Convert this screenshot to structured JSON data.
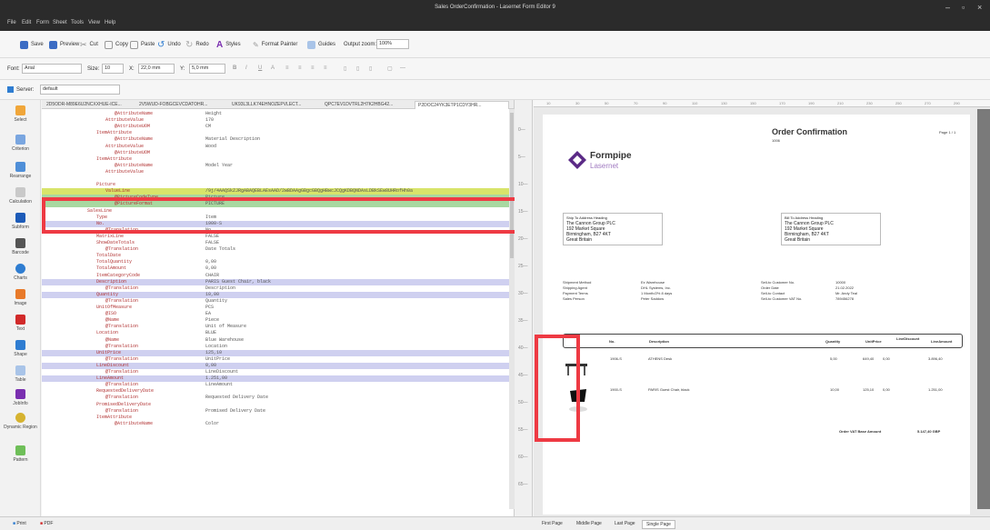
{
  "window": {
    "title": "Sales OrderConfirmation - Lasernet Form Editor 9"
  },
  "menu": [
    "File",
    "Edit",
    "Form",
    "Sheet",
    "Tools",
    "View",
    "Help"
  ],
  "toolbar1": {
    "save": "Save",
    "preview": "Preview",
    "cut": "Cut",
    "copy": "Copy",
    "paste": "Paste",
    "undo": "Undo",
    "redo": "Redo",
    "styles": "Styles",
    "format_painter": "Format Painter",
    "guides": "Guides",
    "output_zoom_label": "Output zoom:",
    "output_zoom_value": "100%"
  },
  "toolbar2": {
    "font_label": "Font:",
    "font_value": "Arial",
    "size_label": "Size:",
    "size_value": "10",
    "x_label": "X:",
    "x_value": "22,0 mm",
    "y_label": "Y:",
    "y_value": "5,0 mm"
  },
  "toolbar3": {
    "server_label": "Server:",
    "server_value": "default"
  },
  "tools": [
    "Select",
    "Criterion",
    "Rearrange",
    "Calculation",
    "Subform",
    "Barcode",
    "Charts",
    "Image",
    "Text",
    "Shape",
    "Table",
    "JobInfo",
    "Dynamic Region",
    "Pattern"
  ],
  "tabs": [
    "2D5ODR-M89E6U2NCXXHUE-ICE...",
    "2V5WUD-FOBGCEVCDATOHR...",
    "UK93L3LLK74EHNOZEPVLECT...",
    "QPC7EV1DVTRL2H7K2HBG42...",
    "P2DOC24YK3ETP1CDY3HR..."
  ],
  "xml_rows": [
    {
      "k": "@AttributeName",
      "v": "Height",
      "i": 4,
      "c": ""
    },
    {
      "k": "AttributeValue",
      "v": "170",
      "i": 3,
      "c": ""
    },
    {
      "k": "@AttributeUOM",
      "v": "CM",
      "i": 4,
      "c": ""
    },
    {
      "k": "ItemAttribute",
      "v": "",
      "i": 2,
      "c": ""
    },
    {
      "k": "@AttributeName",
      "v": "Material Description",
      "i": 4,
      "c": ""
    },
    {
      "k": "AttributeValue",
      "v": "Wood",
      "i": 3,
      "c": ""
    },
    {
      "k": "@AttributeUOM",
      "v": "",
      "i": 4,
      "c": ""
    },
    {
      "k": "ItemAttribute",
      "v": "",
      "i": 2,
      "c": ""
    },
    {
      "k": "@AttributeName",
      "v": "Model Year",
      "i": 4,
      "c": ""
    },
    {
      "k": "AttributeValue",
      "v": "",
      "i": 3,
      "c": ""
    },
    {
      "k": "",
      "v": "",
      "i": 0,
      "c": ""
    },
    {
      "k": "Picture",
      "v": "",
      "i": 2,
      "c": ""
    },
    {
      "k": "ValueLine",
      "v": "/9j/4AAQSkZJRgABAQEBLAEsAAD/2wBDAAgGBgcGBQgHBwcJCQgKDBQNDAsLDBkSEw8UHRofHh0a",
      "i": 3,
      "c": "yl"
    },
    {
      "k": "@PictureCodeType",
      "v": "Picture",
      "i": 4,
      "c": "gr"
    },
    {
      "k": "@PictureFormat",
      "v": "PICTURE",
      "i": 4,
      "c": "gr"
    },
    {
      "k": "SalesLine",
      "v": "",
      "i": 1,
      "c": ""
    },
    {
      "k": "Type",
      "v": "Item",
      "i": 2,
      "c": ""
    },
    {
      "k": "No.",
      "v": "1900-S",
      "i": 2,
      "c": "hl"
    },
    {
      "k": "@Translation",
      "v": "No.",
      "i": 3,
      "c": ""
    },
    {
      "k": "MatrixLine",
      "v": "FALSE",
      "i": 2,
      "c": ""
    },
    {
      "k": "ShowDateTotals",
      "v": "FALSE",
      "i": 2,
      "c": ""
    },
    {
      "k": "@Translation",
      "v": "Date Totals",
      "i": 3,
      "c": ""
    },
    {
      "k": "TotalDate",
      "v": "",
      "i": 2,
      "c": ""
    },
    {
      "k": "TotalQuantity",
      "v": "0,00",
      "i": 2,
      "c": ""
    },
    {
      "k": "TotalAmount",
      "v": "0,00",
      "i": 2,
      "c": ""
    },
    {
      "k": "ItemCategoryCode",
      "v": "CHAIR",
      "i": 2,
      "c": ""
    },
    {
      "k": "Description",
      "v": "PARIS Guest Chair, black",
      "i": 2,
      "c": "hl"
    },
    {
      "k": "@Translation",
      "v": "Description",
      "i": 3,
      "c": ""
    },
    {
      "k": "Quantity",
      "v": "10,00",
      "i": 2,
      "c": "hl"
    },
    {
      "k": "@Translation",
      "v": "Quantity",
      "i": 3,
      "c": ""
    },
    {
      "k": "UnitOfMeasure",
      "v": "PCS",
      "i": 2,
      "c": ""
    },
    {
      "k": "@ISO",
      "v": "EA",
      "i": 3,
      "c": ""
    },
    {
      "k": "@Name",
      "v": "Piece",
      "i": 3,
      "c": ""
    },
    {
      "k": "@Translation",
      "v": "Unit of Measure",
      "i": 3,
      "c": ""
    },
    {
      "k": "Location",
      "v": "BLUE",
      "i": 2,
      "c": ""
    },
    {
      "k": "@Name",
      "v": "Blue Warehouse",
      "i": 3,
      "c": ""
    },
    {
      "k": "@Translation",
      "v": "Location",
      "i": 3,
      "c": ""
    },
    {
      "k": "UnitPrice",
      "v": "125,10",
      "i": 2,
      "c": "hl"
    },
    {
      "k": "@Translation",
      "v": "UnitPrice",
      "i": 3,
      "c": ""
    },
    {
      "k": "LineDiscount",
      "v": "0,00",
      "i": 2,
      "c": "hl"
    },
    {
      "k": "@Translation",
      "v": "LineDiscount",
      "i": 3,
      "c": ""
    },
    {
      "k": "LineAmount",
      "v": "1.251,00",
      "i": 2,
      "c": "hl"
    },
    {
      "k": "@Translation",
      "v": "LineAmount",
      "i": 3,
      "c": ""
    },
    {
      "k": "RequestedDeliveryDate",
      "v": "",
      "i": 2,
      "c": ""
    },
    {
      "k": "@Translation",
      "v": "Requested Delivery Date",
      "i": 3,
      "c": ""
    },
    {
      "k": "PromisedDeliveryDate",
      "v": "",
      "i": 2,
      "c": ""
    },
    {
      "k": "@Translation",
      "v": "Promised Delivery Date",
      "i": 3,
      "c": ""
    },
    {
      "k": "ItemAttribute",
      "v": "",
      "i": 2,
      "c": ""
    },
    {
      "k": "@AttributeName",
      "v": "Color",
      "i": 4,
      "c": ""
    }
  ],
  "preview": {
    "title": "Order Confirmation",
    "subtitle": "1006",
    "page": "Page 1 / 1",
    "brand_name": "Formpipe",
    "brand_product": "Lasernet",
    "ship_to": [
      "Ship To Address Heading",
      "The Cannon Group PLC",
      "192 Market Square",
      "Birmingham, B27 4KT",
      "Great Britain"
    ],
    "bill_to": [
      "Bill To Address Heading",
      "The Cannon Group PLC",
      "192 Market Square",
      "Birmingham, B27 4KT",
      "Great Britain"
    ],
    "info_left_labels": [
      "Shipment Method",
      "Shipping Agent",
      "Payment Terms",
      "Sales Person"
    ],
    "info_left_values": [
      "Ex Warehouse",
      "DHL Systems, Inc.",
      "1 Month/2% 8 days",
      "Peter Saddow"
    ],
    "info_right_labels": [
      "Sell-to Customer No.",
      "Order Date",
      "Sell-to Contact",
      "Sell-to Customer VAT No."
    ],
    "info_right_values": [
      "10000",
      "21.02.2022",
      "Mr. Andy Teal",
      "789456278"
    ],
    "col_no": "No.",
    "col_description": "Description",
    "col_quantity": "Quantity",
    "col_unitprice": "UnitPrice",
    "col_discount": "LineDiscount",
    "col_amount": "LineAmount",
    "row1": {
      "no": "1906-S",
      "description": "ATHENS Desk",
      "quantity": "5,00",
      "unitprice": "649,40",
      "discount": "0,00",
      "amount": "3.896,40"
    },
    "row2": {
      "no": "1900-S",
      "description": "PARIS Guest Chair, black",
      "quantity": "10,00",
      "unitprice": "125,10",
      "discount": "0,00",
      "amount": "1.251,00"
    },
    "total_label": "Order VAT Base Amount",
    "total_value": "5.147,40 GBP"
  },
  "status_left": [
    "Print",
    "PDF"
  ],
  "page_tabs": [
    "First Page",
    "Middle Page",
    "Last Page",
    "Single Page"
  ],
  "colors": {
    "accent": "#5b2a86",
    "highlight_red": "#ee3a43"
  }
}
